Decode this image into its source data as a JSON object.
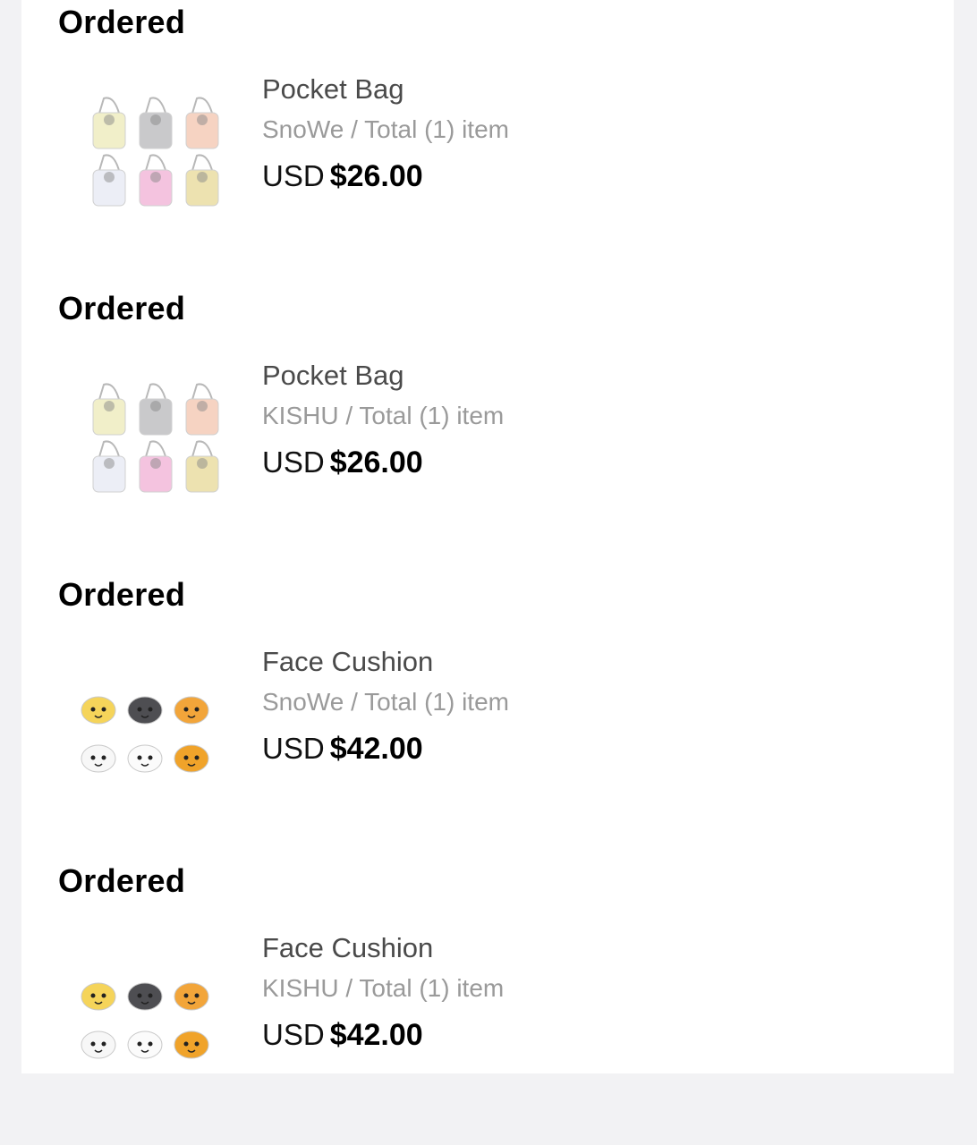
{
  "orders": [
    {
      "status": "Ordered",
      "product": "Pocket Bag",
      "meta": "SnoWe / Total (1) item",
      "currency": "USD",
      "amount": "$26.00",
      "thumbnail_icon": "pocket-bag-thumbnail"
    },
    {
      "status": "Ordered",
      "product": "Pocket Bag",
      "meta": "KISHU / Total (1) item",
      "currency": "USD",
      "amount": "$26.00",
      "thumbnail_icon": "pocket-bag-thumbnail"
    },
    {
      "status": "Ordered",
      "product": "Face Cushion",
      "meta": "SnoWe / Total (1) item",
      "currency": "USD",
      "amount": "$42.00",
      "thumbnail_icon": "face-cushion-thumbnail"
    },
    {
      "status": "Ordered",
      "product": "Face Cushion",
      "meta": "KISHU / Total (1) item",
      "currency": "USD",
      "amount": "$42.00",
      "thumbnail_icon": "face-cushion-thumbnail"
    }
  ],
  "colors": {
    "bag_colors": [
      "#f1efc9",
      "#c9c9cb",
      "#f6d3c2",
      "#eceef6",
      "#f4c3df",
      "#ede2b0"
    ],
    "cushion_colors": [
      "#f5d45a",
      "#4e4e52",
      "#f2a53a",
      "#f7f7f7",
      "#fbfbfb",
      "#f0a32a"
    ]
  }
}
